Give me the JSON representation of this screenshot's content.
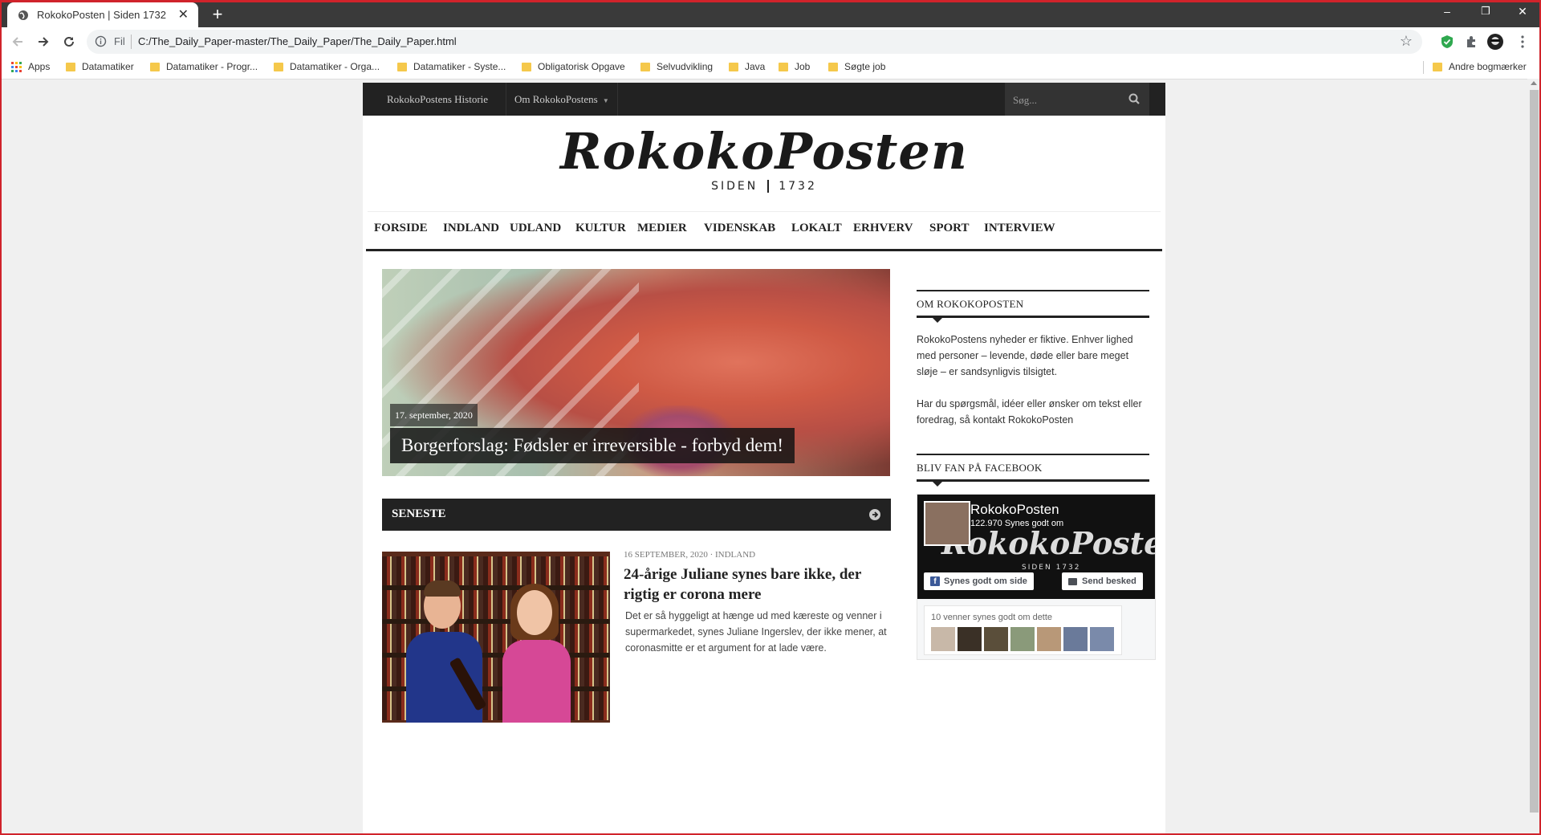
{
  "browser": {
    "tab_title": "RokokoPosten | Siden 1732",
    "new_tab": "+",
    "scheme": "Fil",
    "url": "C:/The_Daily_Paper-master/The_Daily_Paper/The_Daily_Paper.html",
    "window_controls": [
      "–",
      "❐",
      "✕"
    ],
    "bookmarks": [
      "Apps",
      "Datamatiker",
      "Datamatiker - Progr...",
      "Datamatiker - Orga...",
      "Datamatiker - Syste...",
      "Obligatorisk Opgave",
      "Selvudvikling",
      "Java",
      "Job",
      "Søgte job"
    ],
    "other_bookmarks": "Andre bogmærker",
    "accent": "#d0232b"
  },
  "site": {
    "topnav": [
      "RokokoPostens Historie",
      "Om RokokoPostens"
    ],
    "search_placeholder": "Søg...",
    "logo": "RokokoPosten",
    "logo_sub_left": "SIDEN",
    "logo_sub_right": "1732",
    "mainnav": [
      "FORSIDE",
      "INDLAND",
      "UDLAND",
      "KULTUR",
      "MEDIER",
      "VIDENSKAB",
      "LOKALT",
      "ERHVERV",
      "SPORT",
      "INTERVIEW"
    ]
  },
  "hero": {
    "date": "17. september, 2020",
    "headline": "Borgerforslag: Fødsler er irreversible - forbyd dem!"
  },
  "seneste": {
    "label": "SENESTE"
  },
  "article": {
    "date": "16 SEPTEMBER, 2020",
    "sep": " · ",
    "category": "INDLAND",
    "title": "24-årige Juliane synes bare ikke, der rigtig er corona mere",
    "excerpt": "Det er så hyggeligt at hænge ud med kæreste og venner i supermarkedet, synes Juliane Ingerslev, der ikke mener, at coronasmitte er et argument for at lade være."
  },
  "sidebar": {
    "about_title": "OM ROKOKOPOSTEN",
    "about_text1": "RokokoPostens nyheder er fiktive. Enhver lighed med personer – levende, døde eller bare meget sløje – er sandsynligvis tilsigtet.",
    "about_text2_pre": "Har du spørgsmål, idéer eller ønsker om tekst eller foredrag, så ",
    "about_link": "kontakt RokokoPosten",
    "fb_title": "BLIV FAN PÅ FACEBOOK",
    "fb_name": "RokokoPosten",
    "fb_likes": "122.970 Synes godt om",
    "fb_like_btn": "Synes godt om side",
    "fb_msg_btn": "Send besked",
    "fb_friends": "10 venner synes godt om dette",
    "fb_cover_text": "RokokoPosten",
    "fb_cover_sub": "SIDEN  1732"
  }
}
